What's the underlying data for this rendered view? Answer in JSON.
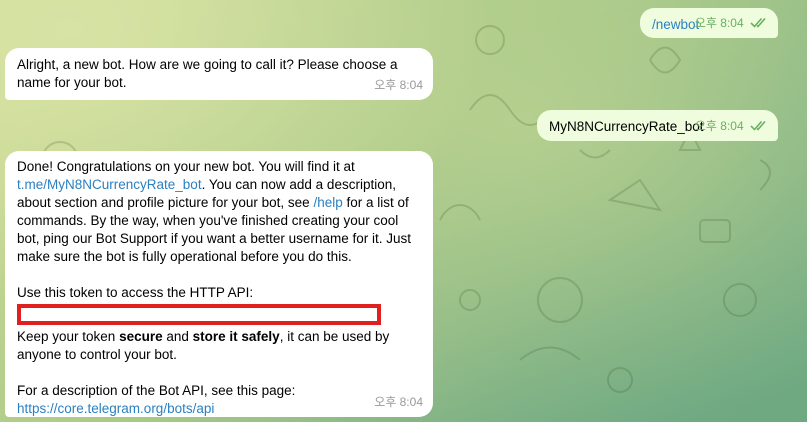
{
  "messages": {
    "m1": {
      "text": "/newbot",
      "time": "오후 8:04"
    },
    "m2": {
      "text": "Alright, a new bot. How are we going to call it? Please choose a name for your bot.",
      "time": "오후 8:04"
    },
    "m3": {
      "text": "MyN8NCurrencyRate_bot",
      "time": "오후 8:04"
    },
    "m4": {
      "line1": "Done! Congratulations on your new bot. You will find it at",
      "bot_link": "t.me/MyN8NCurrencyRate_bot",
      "line2_after_link": ". You can now add a description, about section and profile picture for your bot, see ",
      "help_cmd": "/help",
      "line3": " for a list of commands. By the way, when you've finished creating your cool bot, ping our Bot Support if you want a better username for it. Just make sure the bot is fully operational before you do this.",
      "token_label": "Use this token to access the HTTP API:",
      "keep_pre": "Keep your token ",
      "keep_secure": "secure",
      "keep_and": " and ",
      "keep_store": "store it safely",
      "keep_post": ", it can be used by anyone to control your bot.",
      "api_desc": "For a description of the Bot API, see this page:",
      "api_link": "https://core.telegram.org/bots/api",
      "time": "오후 8:04"
    }
  },
  "colors": {
    "outgoing_bubble": "#effdde",
    "incoming_bubble": "#ffffff",
    "link": "#2b80c2",
    "read_check": "#6cae62",
    "redaction_box": "#e0201e"
  },
  "icons": {
    "read_receipt": "double-check-icon"
  }
}
